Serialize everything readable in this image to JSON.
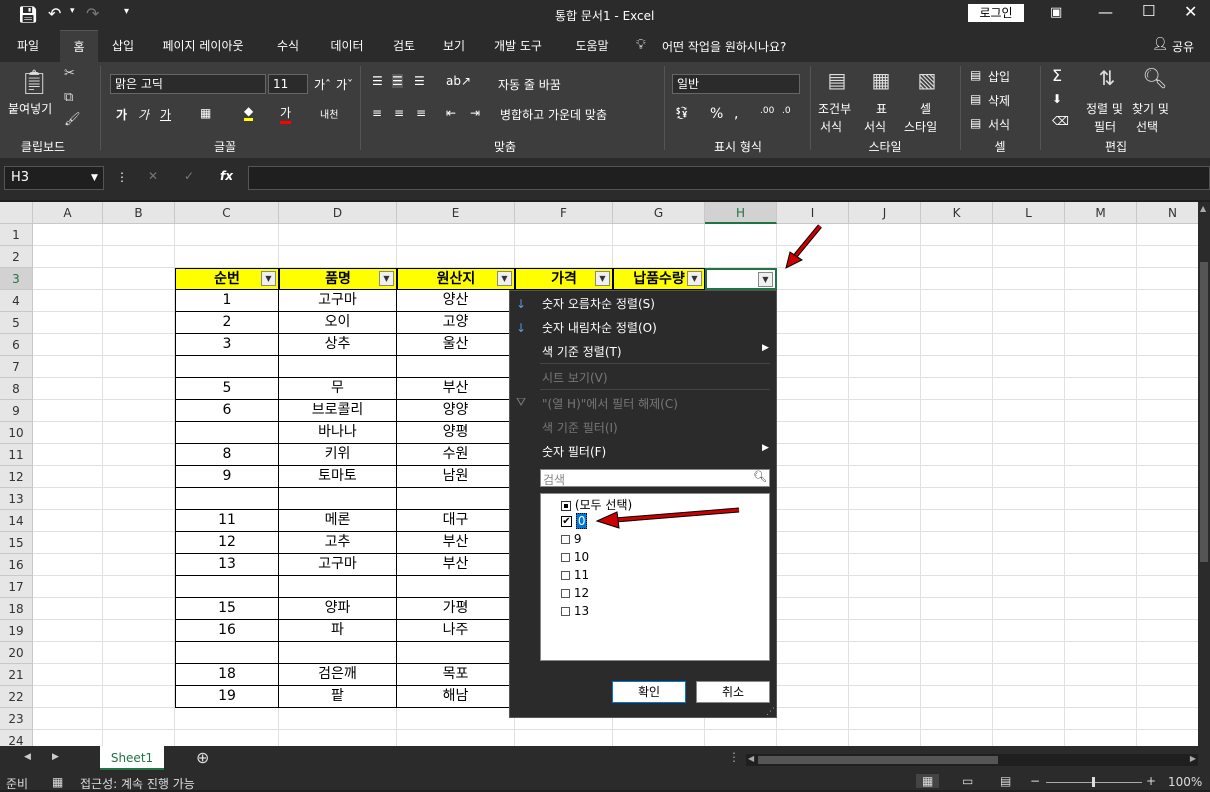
{
  "titlebar": {
    "title": "통합 문서1 - Excel",
    "login": "로그인"
  },
  "menu": [
    "파일",
    "홈",
    "삽입",
    "페이지 레이아웃",
    "수식",
    "데이터",
    "검토",
    "보기",
    "개발 도구",
    "도움말"
  ],
  "tellme": "어떤 작업을 원하시나요?",
  "share": "공유",
  "ribbon": {
    "paste": "붙여넣기",
    "font_name": "맑은 고딕",
    "font_size": "11",
    "wrap": "자동 줄 바꿈",
    "merge": "병합하고 가운데 맞춤",
    "number_format": "일반",
    "cond_format": "조건부\n서식",
    "cond1": "조건부",
    "cond2": "서식",
    "table1": "표",
    "table2": "서식",
    "cellstyle1": "셀",
    "cellstyle2": "스타일",
    "insert": "삽입",
    "delete": "삭제",
    "format": "서식",
    "sort1": "정렬 및",
    "sort2": "필터",
    "find1": "찾기 및",
    "find2": "선택",
    "groups": {
      "clipboard": "클립보드",
      "font": "글꼴",
      "align": "맞춤",
      "number": "표시 형식",
      "styles": "스타일",
      "cells": "셀",
      "editing": "편집"
    }
  },
  "namebox": "H3",
  "fx": "fx",
  "columns": [
    "A",
    "B",
    "C",
    "D",
    "E",
    "F",
    "G",
    "H",
    "I",
    "J",
    "K",
    "L",
    "M",
    "N"
  ],
  "rows": [
    "1",
    "2",
    "3",
    "4",
    "5",
    "6",
    "7",
    "8",
    "9",
    "10",
    "11",
    "12",
    "13",
    "14",
    "15",
    "16",
    "17",
    "18",
    "19",
    "20",
    "21",
    "22",
    "23",
    "24"
  ],
  "headers": [
    "순번",
    "품명",
    "원산지",
    "가격",
    "납품수량"
  ],
  "table": [
    [
      "1",
      "고구마",
      "양산"
    ],
    [
      "2",
      "오이",
      "고양"
    ],
    [
      "3",
      "상추",
      "울산"
    ],
    [
      "",
      "",
      " "
    ],
    [
      "5",
      "무",
      "부산"
    ],
    [
      "6",
      "브로콜리",
      "양양"
    ],
    [
      "",
      "바나나",
      "양평"
    ],
    [
      "8",
      "키위",
      "수원"
    ],
    [
      "9",
      "토마토",
      "남원"
    ],
    [
      "",
      "",
      ""
    ],
    [
      "11",
      "메론",
      "대구"
    ],
    [
      "12",
      "고추",
      "부산"
    ],
    [
      "13",
      "고구마",
      "부산"
    ],
    [
      "",
      "",
      ""
    ],
    [
      "15",
      "양파",
      "가평"
    ],
    [
      "16",
      "파",
      "나주"
    ],
    [
      "",
      "",
      ""
    ],
    [
      "18",
      "검은깨",
      "목포"
    ],
    [
      "19",
      "팥",
      "해남"
    ]
  ],
  "dropdown": {
    "sort_asc": "숫자 오름차순 정렬(S)",
    "sort_desc": "숫자 내림차순 정렬(O)",
    "sort_color": "색 기준 정렬(T)",
    "sheet_view": "시트 보기(V)",
    "clear_filter": "\"(열 H)\"에서 필터 해제(C)",
    "filter_color": "색 기준 필터(I)",
    "number_filter": "숫자 필터(F)",
    "search_placeholder": "검색",
    "select_all": "(모두 선택)",
    "values": [
      "0",
      "9",
      "10",
      "11",
      "12",
      "13"
    ],
    "ok": "확인",
    "cancel": "취소"
  },
  "sheet_tab": "Sheet1",
  "status": {
    "ready": "준비",
    "accessibility": "접근성: 계속 진행 가능",
    "zoom": "100%"
  },
  "colors": {
    "header_fill": "#ffff00",
    "arrow": "#cc0000",
    "excel_green": "#217346"
  }
}
